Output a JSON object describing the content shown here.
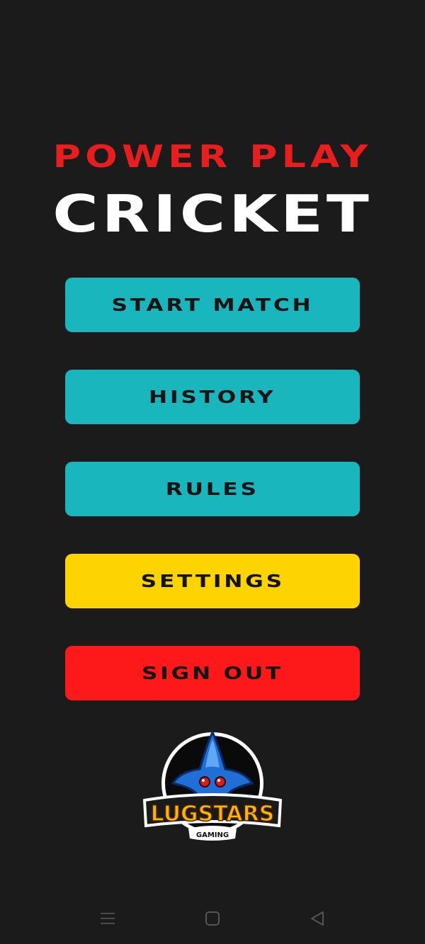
{
  "title": {
    "line1": "POWER PLAY",
    "line2": "CRICKET"
  },
  "menu": {
    "start_match": "START MATCH",
    "history": "HISTORY",
    "rules": "RULES",
    "settings": "SETTINGS",
    "sign_out": "SIGN OUT"
  },
  "logo": {
    "brand": "LUGSTARS",
    "sub": "GAMING"
  },
  "colors": {
    "background": "#1b1b1b",
    "title_red": "#e61e1e",
    "teal": "#1ab6bd",
    "yellow": "#fdd300",
    "red": "#fd1919"
  },
  "system_nav": {
    "icons": [
      "menu-icon",
      "home-square-icon",
      "back-triangle-icon"
    ]
  }
}
